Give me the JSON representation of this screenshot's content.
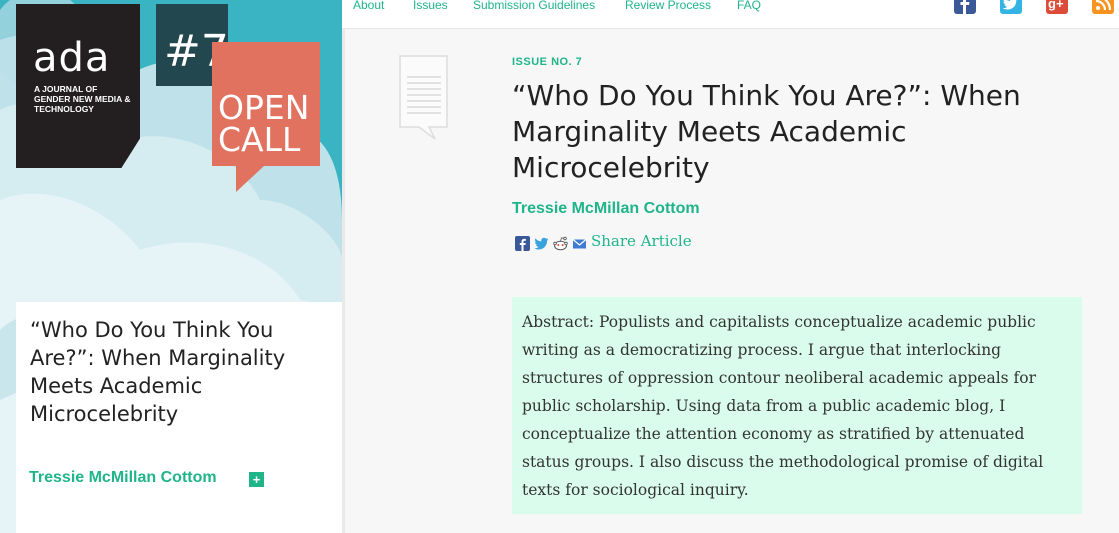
{
  "colors": {
    "accent": "#1fb589",
    "sidebar_bg": "#3ab3c2",
    "logo_bg": "#231f20",
    "issue_badge_bg": "#23474f",
    "open_call_bg": "#e0725f",
    "abstract_bg": "#d9fcec"
  },
  "sidebar": {
    "logo": "ada",
    "logo_subtitle": "A Journal of Gender New Media & Technology",
    "issue_badge": "#7",
    "open_call": "OPEN CALL",
    "card": {
      "title": "“Who Do You Think You Are?”: When Marginality Meets Academic Microcelebrity",
      "author": "Tressie McMillan Cottom",
      "expand_icon": "plus-icon"
    }
  },
  "nav": {
    "items": [
      "About",
      "Issues",
      "Submission Guidelines",
      "Review Process",
      "FAQ"
    ],
    "social": [
      "facebook-icon",
      "twitter-icon",
      "google-plus-icon",
      "rss-icon"
    ]
  },
  "article": {
    "issue": "ISSUE NO. 7",
    "title": "“Who Do You Think You Are?”: When Marginality Meets Academic Microcelebrity",
    "author": "Tressie McMillan Cottom",
    "share_icons": [
      "facebook-icon",
      "twitter-icon",
      "reddit-icon",
      "email-icon"
    ],
    "share_label": "Share Article",
    "abstract": "Abstract: Populists and capitalists conceptualize academic public writing as a democratizing process. I argue that interlocking structures of oppression contour neoliberal academic appeals for public scholarship. Using data from a public academic blog, I conceptualize the attention economy as stratified by attenuated status groups. I also discuss the methodological promise of digital texts for sociological inquiry."
  }
}
